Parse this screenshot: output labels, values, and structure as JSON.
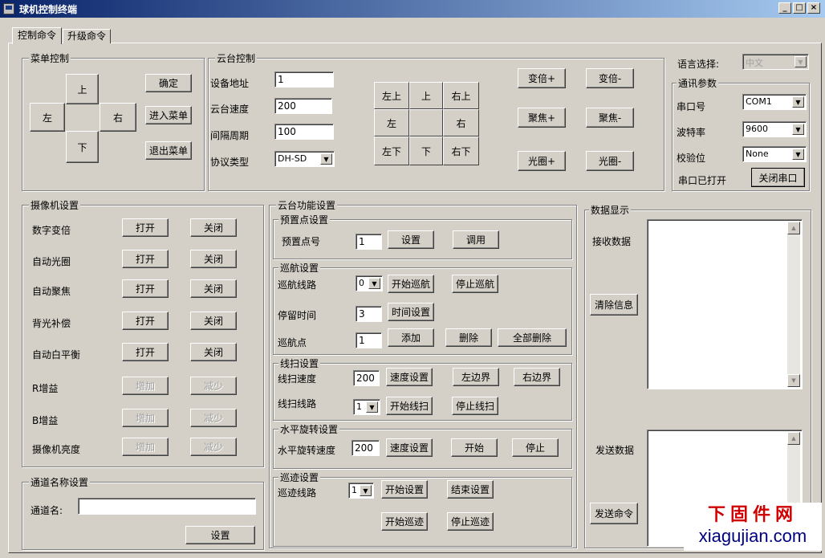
{
  "window": {
    "title": "球机控制终端",
    "min_label": "_",
    "max_label": "□",
    "close_label": "×"
  },
  "tabs": [
    "控制命令",
    "升级命令"
  ],
  "menu": {
    "legend": "菜单控制",
    "up": "上",
    "down": "下",
    "left": "左",
    "right": "右",
    "confirm": "确定",
    "enter": "进入菜单",
    "exit": "退出菜单"
  },
  "ptz": {
    "legend": "云台控制",
    "address_label": "设备地址",
    "address_value": "1",
    "speed_label": "云台速度",
    "speed_value": "200",
    "interval_label": "间隔周期",
    "interval_value": "100",
    "protocol_label": "协议类型",
    "protocol_value": "DH-SD",
    "dir": {
      "ul": "左上",
      "u": "上",
      "ur": "右上",
      "l": "左",
      "r": "右",
      "dl": "左下",
      "d": "下",
      "dr": "右下"
    },
    "zoom_in": "变倍+",
    "zoom_out": "变倍-",
    "focus_in": "聚焦+",
    "focus_out": "聚焦-",
    "iris_in": "光圈+",
    "iris_out": "光圈-"
  },
  "language": {
    "label": "语言选择:",
    "value": "中文"
  },
  "comm": {
    "legend": "通讯参数",
    "port_label": "串口号",
    "port_value": "COM1",
    "baud_label": "波特率",
    "baud_value": "9600",
    "parity_label": "校验位",
    "parity_value": "None",
    "status": "串口已打开",
    "close_button": "关闭串口"
  },
  "camera": {
    "legend": "摄像机设置",
    "rows": [
      {
        "label": "数字变倍",
        "on": "打开",
        "off": "关闭",
        "enabled": true
      },
      {
        "label": "自动光圈",
        "on": "打开",
        "off": "关闭",
        "enabled": true
      },
      {
        "label": "自动聚焦",
        "on": "打开",
        "off": "关闭",
        "enabled": true
      },
      {
        "label": "背光补偿",
        "on": "打开",
        "off": "关闭",
        "enabled": true
      },
      {
        "label": "自动白平衡",
        "on": "打开",
        "off": "关闭",
        "enabled": true
      },
      {
        "label": "R增益",
        "on": "增加",
        "off": "减少",
        "enabled": false
      },
      {
        "label": "B增益",
        "on": "增加",
        "off": "减少",
        "enabled": false
      },
      {
        "label": "摄像机亮度",
        "on": "增加",
        "off": "减少",
        "enabled": false
      }
    ]
  },
  "channel": {
    "legend": "通道名称设置",
    "label": "通道名:",
    "value": "",
    "set": "设置"
  },
  "ptzfunc": {
    "legend": "云台功能设置",
    "preset": {
      "legend": "预置点设置",
      "label": "预置点号",
      "value": "1",
      "set": "设置",
      "call": "调用"
    },
    "tour": {
      "legend": "巡航设置",
      "route_label": "巡航线路",
      "route_value": "0",
      "start": "开始巡航",
      "stop": "停止巡航",
      "dwell_label": "停留时间",
      "dwell_value": "3",
      "time_set": "时间设置",
      "point_label": "巡航点",
      "point_value": "1",
      "add": "添加",
      "delete": "删除",
      "delete_all": "全部删除"
    },
    "scan": {
      "legend": "线扫设置",
      "speed_label": "线扫速度",
      "speed_value": "200",
      "speed_set": "速度设置",
      "left": "左边界",
      "right": "右边界",
      "route_label": "线扫线路",
      "route_value": "1",
      "start": "开始线扫",
      "stop": "停止线扫"
    },
    "rotate": {
      "legend": "水平旋转设置",
      "speed_label": "水平旋转速度",
      "speed_value": "200",
      "speed_set": "速度设置",
      "start": "开始",
      "stop": "停止"
    },
    "pattern": {
      "legend": "巡迹设置",
      "route_label": "巡迹线路",
      "route_value": "1",
      "start_set": "开始设置",
      "end_set": "结束设置",
      "start": "开始巡迹",
      "stop": "停止巡迹"
    }
  },
  "data": {
    "legend": "数据显示",
    "receive_label": "接收数据",
    "clear": "清除信息",
    "send_label": "发送数据",
    "send": "发送命令"
  },
  "watermark": {
    "line1": "下固件网",
    "line2": "xiagujian.com"
  }
}
